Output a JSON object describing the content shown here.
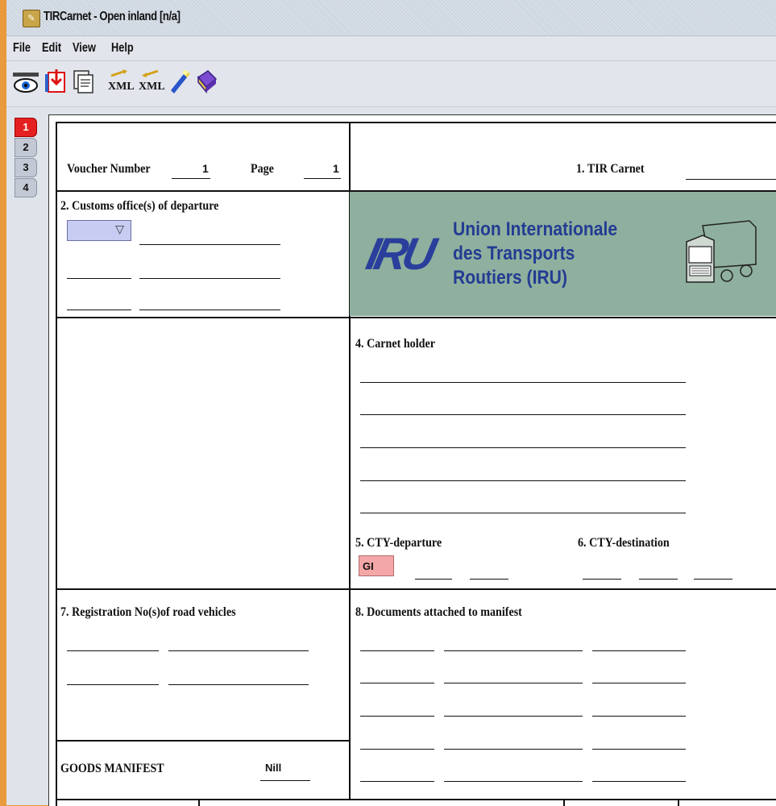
{
  "window": {
    "title": "TIRCarnet - Open inland [n/a]"
  },
  "menu": [
    "File",
    "Edit",
    "View",
    "Help"
  ],
  "tabs": [
    "1",
    "2",
    "3",
    "4"
  ],
  "form": {
    "voucher_label": "Voucher Number",
    "voucher_value": "1",
    "page_label": "Page",
    "page_value": "1",
    "tir_carnet_label": "1. TIR Carnet",
    "customs_label": "2. Customs office(s) of departure",
    "customs_select_value": "",
    "iru": {
      "logo": "IRU",
      "line1": "Union Internationale",
      "line2": "des Transports",
      "line3": "Routiers (IRU)"
    },
    "carnet_holder_label": "4. Carnet holder",
    "cty_departure_label": "5. CTY-departure",
    "cty_departure_value": "GI",
    "cty_destination_label": "6. CTY-destination",
    "registration_label": "7. Registration No(s)of road vehicles",
    "documents_label": "8. Documents attached to manifest",
    "goods_manifest_label": "GOODS MANIFEST",
    "goods_manifest_value": "Nill"
  },
  "colors": {
    "active_tab": "#e52020",
    "iru_background": "#8fb09e",
    "iru_text": "#233c93",
    "cty_field": "#f3a7a7",
    "select_field": "#c8ccf2"
  }
}
